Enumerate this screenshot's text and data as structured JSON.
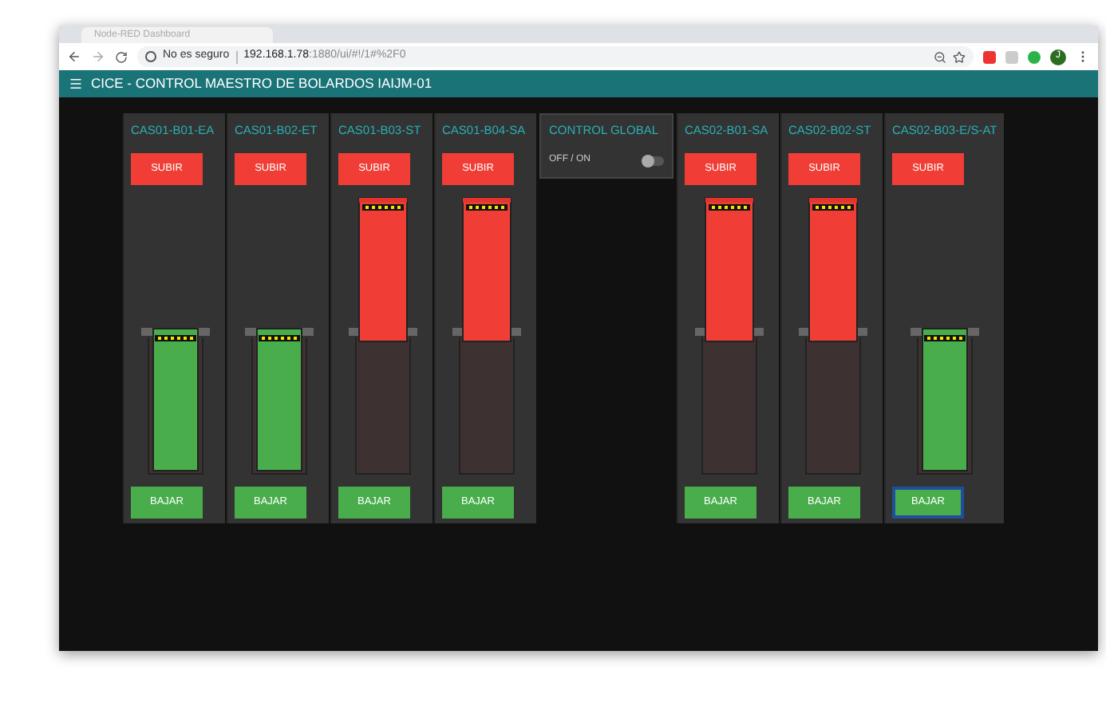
{
  "browser": {
    "tab_title": "Node-RED Dashboard",
    "security": "No es seguro",
    "url_host": "192.168.1.78",
    "url_rest": ":1880/ui/#!/1#%2F0",
    "avatar_letter": "J"
  },
  "header": {
    "title": "CICE - CONTROL MAESTRO DE BOLARDOS IAIJM-01"
  },
  "columns": [
    {
      "kind": "bollard",
      "name": "CAS01-B01-EA",
      "up_button": "SUBIR",
      "down_button": "BAJAR",
      "raised": false,
      "focused": false
    },
    {
      "kind": "bollard",
      "name": "CAS01-B02-ET",
      "up_button": "SUBIR",
      "down_button": "BAJAR",
      "raised": false,
      "focused": false
    },
    {
      "kind": "bollard",
      "name": "CAS01-B03-ST",
      "up_button": "SUBIR",
      "down_button": "BAJAR",
      "raised": true,
      "focused": false
    },
    {
      "kind": "bollard",
      "name": "CAS01-B04-SA",
      "up_button": "SUBIR",
      "down_button": "BAJAR",
      "raised": true,
      "focused": false
    },
    {
      "kind": "switch",
      "name": "CONTROL GLOBAL",
      "label": "OFF / ON",
      "on": false
    },
    {
      "kind": "bollard",
      "name": "CAS02-B01-SA",
      "up_button": "SUBIR",
      "down_button": "BAJAR",
      "raised": true,
      "focused": false
    },
    {
      "kind": "bollard",
      "name": "CAS02-B02-ST",
      "up_button": "SUBIR",
      "down_button": "BAJAR",
      "raised": true,
      "focused": false
    },
    {
      "kind": "bollard",
      "name": "CAS02-B03-E/S-AT",
      "up_button": "SUBIR",
      "down_button": "BAJAR",
      "raised": false,
      "focused": true
    }
  ]
}
